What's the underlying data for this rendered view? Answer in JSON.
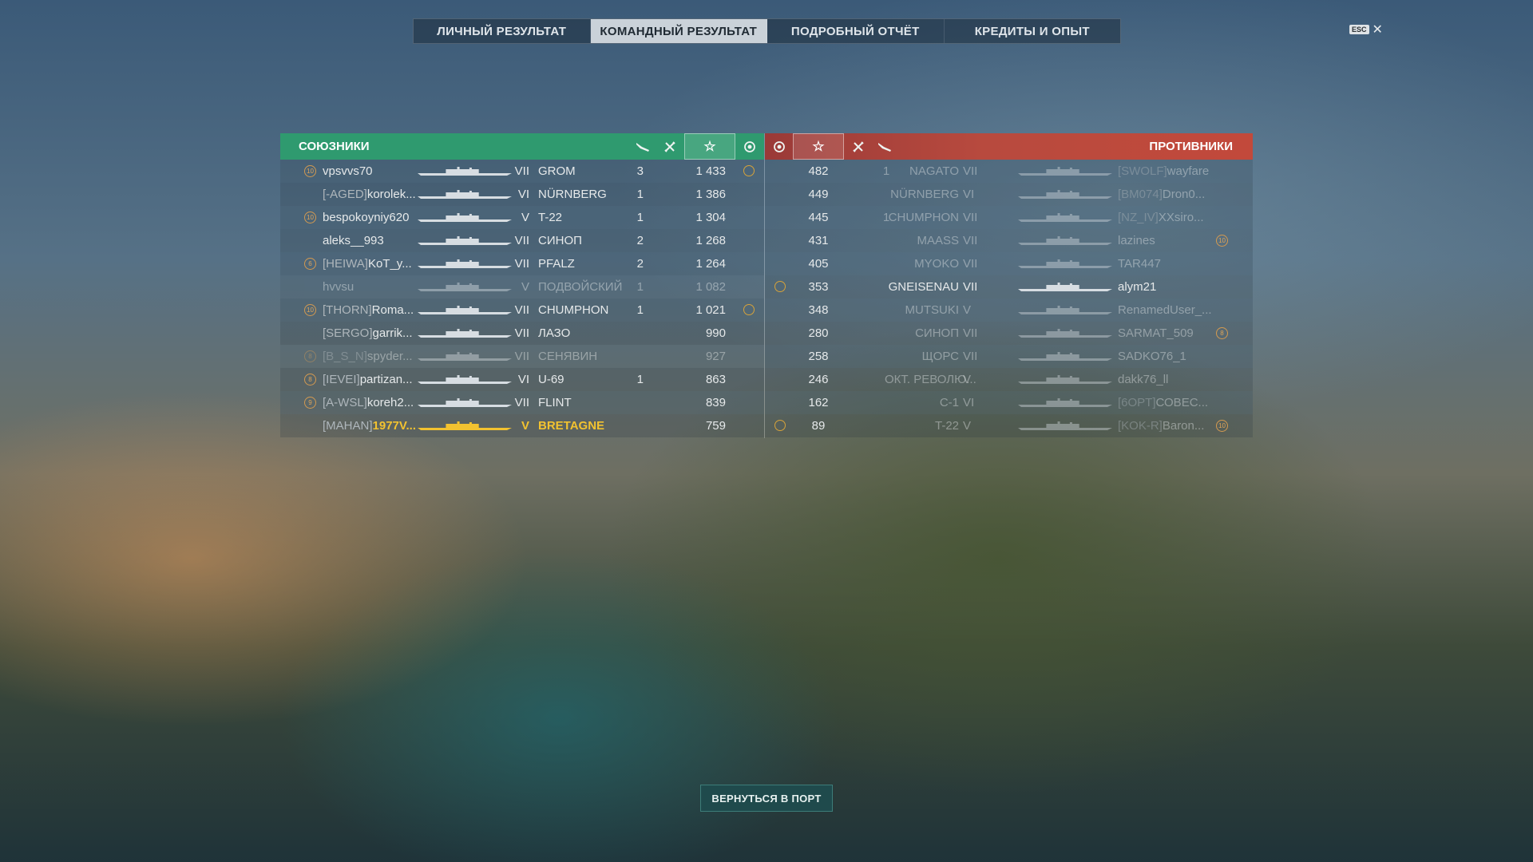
{
  "tabs": [
    {
      "label": "ЛИЧНЫЙ РЕЗУЛЬТАТ"
    },
    {
      "label": "КОМАНДНЫЙ РЕЗУЛЬТАТ"
    },
    {
      "label": "ПОДРОБНЫЙ ОТЧЁТ"
    },
    {
      "label": "КРЕДИТЫ И ОПЫТ"
    }
  ],
  "active_tab": "КОМАНДНЫЙ РЕЗУЛЬТАТ",
  "esc": {
    "key": "ESC",
    "close": "✕"
  },
  "allies": {
    "title": "СОЮЗНИКИ",
    "icons": [
      "plane-shot-icon",
      "kills-icon",
      "star-icon",
      "medal-icon"
    ],
    "rows": [
      {
        "badge": "10",
        "clan": "",
        "name": "vpsvvs70",
        "tier": "VII",
        "ship": "GROM",
        "kills": "3",
        "xp": "1 433",
        "medal": true,
        "dim": false,
        "hi": false
      },
      {
        "badge": "",
        "clan": "[-AGED]",
        "name": "korolek...",
        "tier": "VI",
        "ship": "NÜRNBERG",
        "kills": "1",
        "xp": "1 386",
        "medal": false,
        "dim": false,
        "hi": false
      },
      {
        "badge": "10",
        "clan": "",
        "name": "bespokoyniy620",
        "tier": "V",
        "ship": "T-22",
        "kills": "1",
        "xp": "1 304",
        "medal": false,
        "dim": false,
        "hi": false
      },
      {
        "badge": "",
        "clan": "",
        "name": "aleks__993",
        "tier": "VII",
        "ship": "СИНОП",
        "kills": "2",
        "xp": "1 268",
        "medal": false,
        "dim": false,
        "hi": false
      },
      {
        "badge": "6",
        "clan": "[HEIWA]",
        "name": "KoT_y...",
        "tier": "VII",
        "ship": "PFALZ",
        "kills": "2",
        "xp": "1 264",
        "medal": false,
        "dim": false,
        "hi": false
      },
      {
        "badge": "",
        "clan": "",
        "name": "hvvsu",
        "tier": "V",
        "ship": "ПОДВОЙСКИЙ",
        "kills": "1",
        "xp": "1 082",
        "medal": false,
        "dim": true,
        "hi": false
      },
      {
        "badge": "10",
        "clan": "[THORN]",
        "name": "Roma...",
        "tier": "VII",
        "ship": "CHUMPHON",
        "kills": "1",
        "xp": "1 021",
        "medal": true,
        "dim": false,
        "hi": false
      },
      {
        "badge": "",
        "clan": "[SERGO]",
        "name": "garrik...",
        "tier": "VII",
        "ship": "ЛАЗО",
        "kills": "",
        "xp": "990",
        "medal": false,
        "dim": false,
        "hi": false
      },
      {
        "badge": "8",
        "clan": "[B_S_N]",
        "name": "spyder...",
        "tier": "VII",
        "ship": "СЕНЯВИН",
        "kills": "",
        "xp": "927",
        "medal": false,
        "dim": true,
        "hi": false
      },
      {
        "badge": "8",
        "clan": "[IEVEI]",
        "name": "partizan...",
        "tier": "VI",
        "ship": "U-69",
        "kills": "1",
        "xp": "863",
        "medal": false,
        "dim": false,
        "hi": false
      },
      {
        "badge": "9",
        "clan": "[A-WSL]",
        "name": "koreh2...",
        "tier": "VII",
        "ship": "FLINT",
        "kills": "",
        "xp": "839",
        "medal": false,
        "dim": false,
        "hi": false
      },
      {
        "badge": "",
        "clan": "[MAHAN]",
        "name": "1977V...",
        "tier": "V",
        "ship": "BRETAGNE",
        "kills": "",
        "xp": "759",
        "medal": false,
        "dim": false,
        "hi": true
      }
    ]
  },
  "enemies": {
    "title": "ПРОТИВНИКИ",
    "icons": [
      "medal-icon",
      "star-icon",
      "kills-icon",
      "plane-shot-icon"
    ],
    "rows": [
      {
        "medal": false,
        "xp": "482",
        "kills": "1",
        "ship": "NAGATO",
        "tier": "VII",
        "clan": "[SWOLF]",
        "name": "wayfare",
        "badge": "",
        "dim": true
      },
      {
        "medal": false,
        "xp": "449",
        "kills": "",
        "ship": "NÜRNBERG",
        "tier": "VI",
        "clan": "[BM074]",
        "name": "Dron0...",
        "badge": "",
        "dim": true
      },
      {
        "medal": false,
        "xp": "445",
        "kills": "1",
        "ship": "CHUMPHON",
        "tier": "VII",
        "clan": "[NZ_IV]",
        "name": "XXsiro...",
        "badge": "",
        "dim": true
      },
      {
        "medal": false,
        "xp": "431",
        "kills": "",
        "ship": "MAASS",
        "tier": "VII",
        "clan": "",
        "name": "lazines",
        "badge": "10",
        "dim": true
      },
      {
        "medal": false,
        "xp": "405",
        "kills": "",
        "ship": "MYOKO",
        "tier": "VII",
        "clan": "",
        "name": "TAR447",
        "badge": "",
        "dim": true
      },
      {
        "medal": true,
        "xp": "353",
        "kills": "",
        "ship": "GNEISENAU",
        "tier": "VII",
        "clan": "",
        "name": "alym21",
        "badge": "",
        "dim": false
      },
      {
        "medal": false,
        "xp": "348",
        "kills": "",
        "ship": "MUTSUKI",
        "tier": "V",
        "clan": "",
        "name": "RenamedUser_...",
        "badge": "",
        "dim": true
      },
      {
        "medal": false,
        "xp": "280",
        "kills": "",
        "ship": "СИНОП",
        "tier": "VII",
        "clan": "",
        "name": "SARMAT_509",
        "badge": "8",
        "dim": true
      },
      {
        "medal": false,
        "xp": "258",
        "kills": "",
        "ship": "ЩОРС",
        "tier": "VII",
        "clan": "",
        "name": "SADKO76_1",
        "badge": "",
        "dim": true
      },
      {
        "medal": false,
        "xp": "246",
        "kills": "",
        "ship": "ОКТ. РЕВОЛЮ...",
        "tier": "V",
        "clan": "",
        "name": "dakk76_ll",
        "badge": "",
        "dim": true
      },
      {
        "medal": false,
        "xp": "162",
        "kills": "",
        "ship": "C-1",
        "tier": "VI",
        "clan": "[6OPT]",
        "name": "СОВЕС...",
        "badge": "",
        "dim": true
      },
      {
        "medal": true,
        "xp": "89",
        "kills": "",
        "ship": "T-22",
        "tier": "V",
        "clan": "[KOK-R]",
        "name": "Baron...",
        "badge": "10",
        "dim": true
      }
    ]
  },
  "return_button": "ВЕРНУТЬСЯ В ПОРТ",
  "colors": {
    "allies": "#2f9a6f",
    "enemies": "#c2493b",
    "highlight": "#f2c230",
    "badge": "#d49a50"
  }
}
